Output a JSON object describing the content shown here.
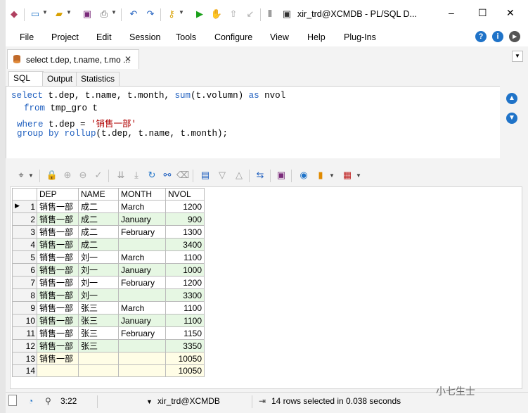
{
  "title_bar": {
    "title": "xir_trd@XCMDB - PL/SQL D...",
    "minimize": "–",
    "maximize": "☐",
    "close": "✕"
  },
  "menu": {
    "items": [
      "File",
      "Project",
      "Edit",
      "Session",
      "Tools",
      "Configure",
      "View",
      "Help",
      "Plug-Ins"
    ]
  },
  "doc_tab": {
    "label": "select t.dep, t.name, t.mo ...",
    "close": "✕"
  },
  "sub_tabs": [
    "SQL",
    "Output",
    "Statistics"
  ],
  "sql": {
    "line1": {
      "select": "select",
      "mid": " t.dep, t.name, t.month, ",
      "fn": "sum",
      "args": "(t.volumn) ",
      "as": "as",
      "alias": " nvol"
    },
    "line2": {
      "from": "from",
      "rest": " tmp_gro t"
    },
    "line3": {
      "where": "where",
      "rest": " t.dep = ",
      "str": "'销售一部'"
    },
    "line4": {
      "group": "group by",
      "fn": " rollup",
      "rest": "(t.dep, t.name, t.month);"
    }
  },
  "grid": {
    "columns": [
      "DEP",
      "NAME",
      "MONTH",
      "NVOL"
    ],
    "rows": [
      {
        "n": "1",
        "dep": "销售一部",
        "name": "成二",
        "month": "March",
        "nvol": "1200"
      },
      {
        "n": "2",
        "dep": "销售一部",
        "name": "成二",
        "month": "January",
        "nvol": "900"
      },
      {
        "n": "3",
        "dep": "销售一部",
        "name": "成二",
        "month": "February",
        "nvol": "1300"
      },
      {
        "n": "4",
        "dep": "销售一部",
        "name": "成二",
        "month": "",
        "nvol": "3400"
      },
      {
        "n": "5",
        "dep": "销售一部",
        "name": "刘一",
        "month": "March",
        "nvol": "1100"
      },
      {
        "n": "6",
        "dep": "销售一部",
        "name": "刘一",
        "month": "January",
        "nvol": "1000"
      },
      {
        "n": "7",
        "dep": "销售一部",
        "name": "刘一",
        "month": "February",
        "nvol": "1200"
      },
      {
        "n": "8",
        "dep": "销售一部",
        "name": "刘一",
        "month": "",
        "nvol": "3300"
      },
      {
        "n": "9",
        "dep": "销售一部",
        "name": "张三",
        "month": "March",
        "nvol": "1100"
      },
      {
        "n": "10",
        "dep": "销售一部",
        "name": "张三",
        "month": "January",
        "nvol": "1100"
      },
      {
        "n": "11",
        "dep": "销售一部",
        "name": "张三",
        "month": "February",
        "nvol": "1150"
      },
      {
        "n": "12",
        "dep": "销售一部",
        "name": "张三",
        "month": "",
        "nvol": "3350"
      },
      {
        "n": "13",
        "dep": "销售一部",
        "name": "",
        "month": "",
        "nvol": "10050"
      },
      {
        "n": "14",
        "dep": "",
        "name": "",
        "month": "",
        "nvol": "10050"
      }
    ]
  },
  "status": {
    "position": "3:22",
    "connection": "xir_trd@XCMDB",
    "message": "14 rows selected in 0.038 seconds"
  },
  "watermark": "小七生士",
  "colors": {
    "keyword": "#1f5fbf",
    "string": "#b00000",
    "row_alt": "#e6f7e3",
    "accent": "#1f73c8"
  },
  "icons": [
    "db-icon",
    "new-icon",
    "open-icon",
    "save-icon",
    "print-icon",
    "undo-icon",
    "redo-icon",
    "key-icon",
    "execute-icon",
    "break-icon",
    "commit-icon",
    "rollback-icon",
    "toolbar-icon"
  ]
}
